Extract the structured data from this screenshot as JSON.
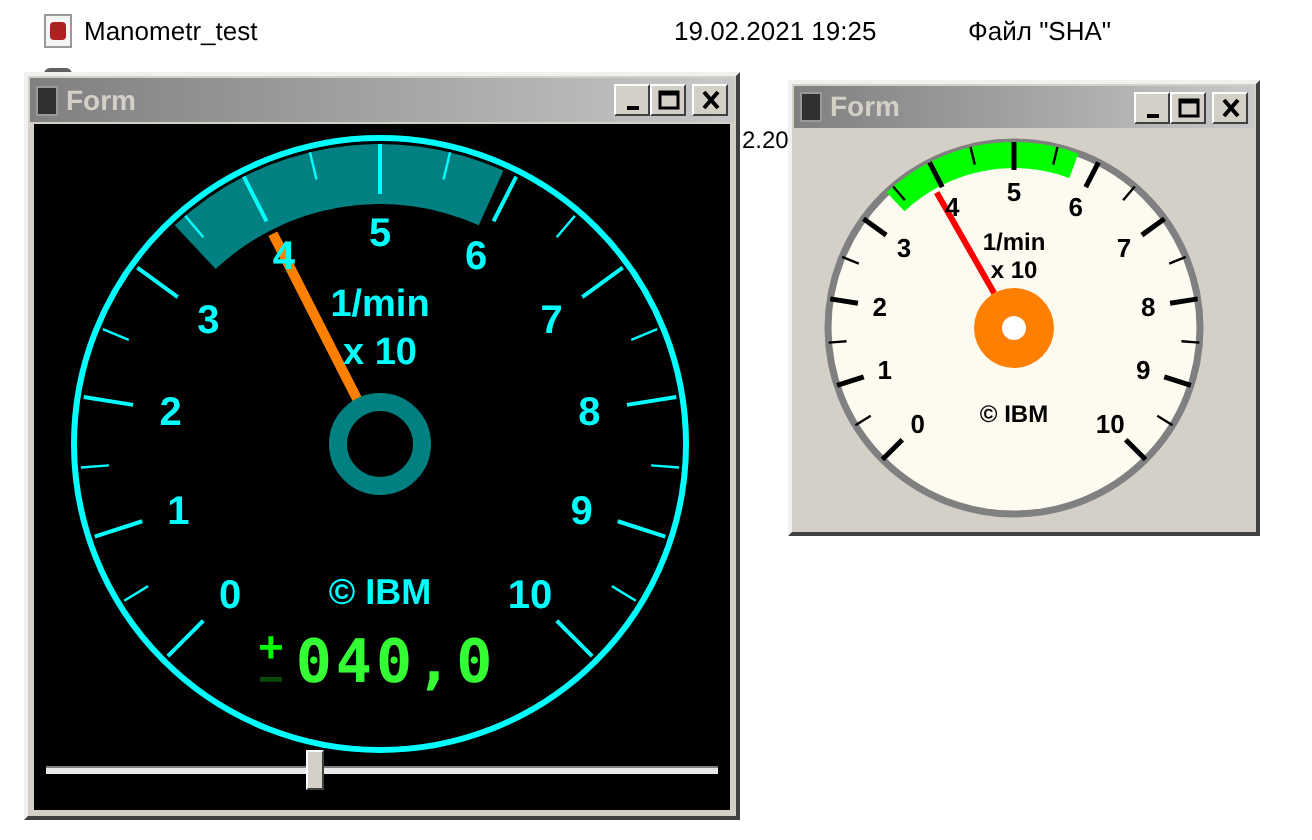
{
  "files": [
    {
      "kind": "file",
      "name": "Manometr_test",
      "date": "19.02.2021 19:25",
      "type": "Файл \"SHA\""
    },
    {
      "kind": "blank"
    },
    {
      "kind": "fragment",
      "date": "2.20"
    }
  ],
  "windows": [
    {
      "title": "Form",
      "gauge": {
        "kind": "dark",
        "labels": [
          "0",
          "1",
          "2",
          "3",
          "4",
          "5",
          "6",
          "7",
          "8",
          "9",
          "10"
        ],
        "unit": "1/min",
        "multiplier": "x 10",
        "brand": "© IBM",
        "level": 0.4
      },
      "readout": {
        "plus": "+",
        "minus": "−",
        "value": "040,0",
        "negative": false
      },
      "slider": {
        "level": 0.4
      }
    },
    {
      "title": "Form",
      "gauge": {
        "kind": "light",
        "labels": [
          "0",
          "1",
          "2",
          "3",
          "4",
          "5",
          "6",
          "7",
          "8",
          "9",
          "10"
        ],
        "unit": "1/min",
        "multiplier": "x 10",
        "brand": "© IBM",
        "level": 0.39
      }
    }
  ]
}
